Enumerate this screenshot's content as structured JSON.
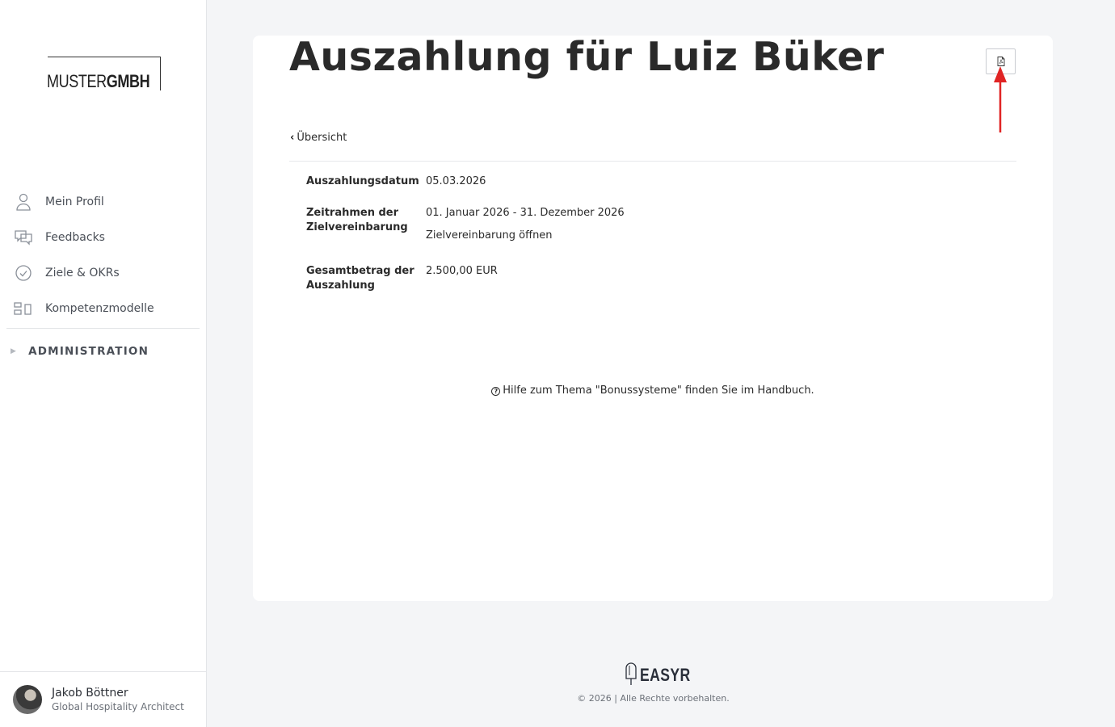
{
  "sidebar": {
    "logo": {
      "part1": "MUSTER",
      "part2": "GMBH"
    },
    "items": [
      {
        "label": "Mein Profil",
        "icon": "user-icon"
      },
      {
        "label": "Feedbacks",
        "icon": "chat-icon"
      },
      {
        "label": "Ziele & OKRs",
        "icon": "check-circle-icon"
      },
      {
        "label": "Kompetenzmodelle",
        "icon": "grid-icon"
      }
    ],
    "admin_label": "ADMINISTRATION",
    "user": {
      "name": "Jakob Böttner",
      "role": "Global Hospitality Architect"
    }
  },
  "main": {
    "title": "Auszahlung für Luiz Büker",
    "back_label": "Übersicht",
    "fields": [
      {
        "label": "Auszahlungsdatum",
        "value": "05.03.2026"
      },
      {
        "label": "Zeitrahmen der Zielvereinbarung",
        "value": "01. Januar 2026 - 31. Dezember 2026",
        "link": "Zielvereinbarung öffnen"
      },
      {
        "label": "Gesamtbetrag der Auszahlung",
        "value": "2.500,00 EUR"
      }
    ],
    "help_text": "Hilfe zum Thema \"Bonussysteme\" finden Sie im Handbuch."
  },
  "footer": {
    "brand": "EASYR",
    "copyright": "© 2026 | Alle Rechte vorbehalten."
  },
  "colors": {
    "accent_arrow": "#e02424",
    "background": "#f4f5f7"
  }
}
